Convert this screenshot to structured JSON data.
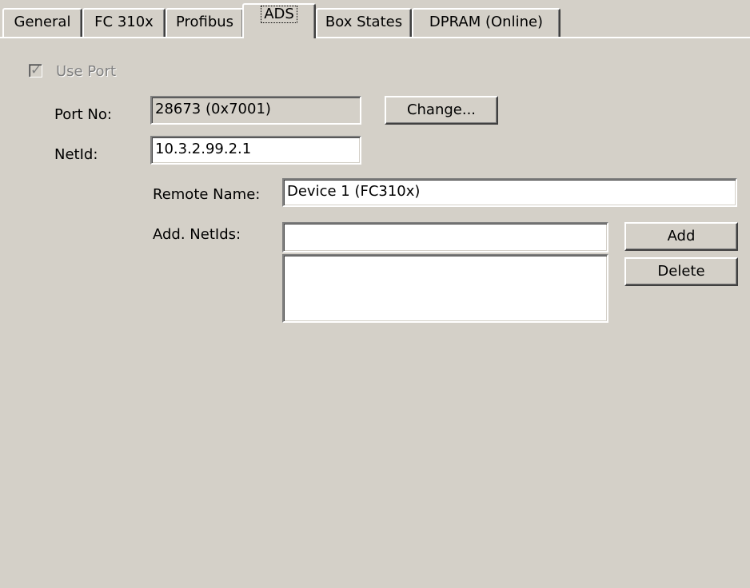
{
  "tabs": [
    {
      "label": "General"
    },
    {
      "label": "FC 310x"
    },
    {
      "label": "Profibus"
    },
    {
      "label": "ADS"
    },
    {
      "label": "Box States"
    },
    {
      "label": "DPRAM (Online)"
    }
  ],
  "active_tab": "ADS",
  "use_port": {
    "label": "Use Port",
    "checked": true,
    "enabled": false
  },
  "port": {
    "label": "Port No:",
    "value": "28673 (0x7001)",
    "change_button": "Change..."
  },
  "netid": {
    "label": "NetId:",
    "value": "10.3.2.99.2.1"
  },
  "remote_name": {
    "label": "Remote Name:",
    "value": "Device 1 (FC310x)"
  },
  "add_netids": {
    "label": "Add. NetIds:",
    "input_value": "",
    "list_items": [],
    "add_button": "Add",
    "delete_button": "Delete"
  }
}
